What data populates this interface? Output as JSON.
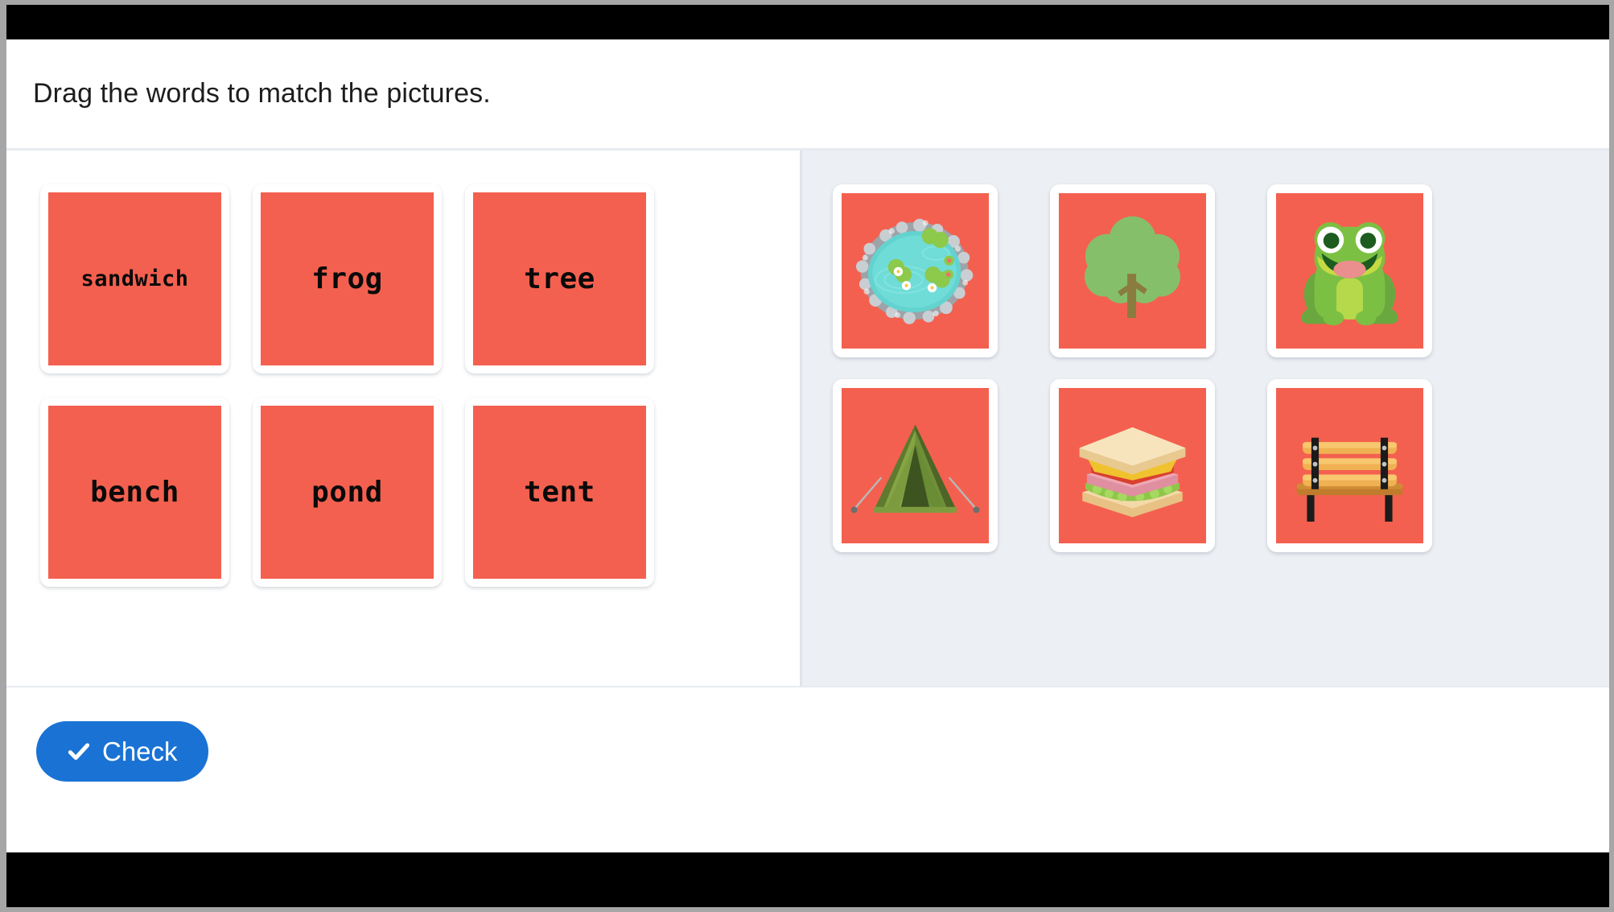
{
  "activity": {
    "instruction": "Drag the words to match the pictures."
  },
  "colors": {
    "tile": "#f4604f",
    "check_button": "#1a73d4",
    "pictures_panel_bg": "#eceff3",
    "divider": "#dfe4ea"
  },
  "words_panel": {
    "name": "word-bank",
    "cards": [
      {
        "label": "sandwich",
        "size": "small"
      },
      {
        "label": "frog",
        "size": "large"
      },
      {
        "label": "tree",
        "size": "large"
      },
      {
        "label": "bench",
        "size": "large"
      },
      {
        "label": "pond",
        "size": "large"
      },
      {
        "label": "tent",
        "size": "large"
      }
    ]
  },
  "pictures_panel": {
    "name": "picture-targets",
    "cards": [
      {
        "icon": "pond-icon",
        "alt": "pond"
      },
      {
        "icon": "tree-icon",
        "alt": "tree"
      },
      {
        "icon": "frog-icon",
        "alt": "frog"
      },
      {
        "icon": "tent-icon",
        "alt": "tent"
      },
      {
        "icon": "sandwich-icon",
        "alt": "sandwich"
      },
      {
        "icon": "bench-icon",
        "alt": "bench"
      }
    ]
  },
  "footer": {
    "check_label": "Check"
  }
}
